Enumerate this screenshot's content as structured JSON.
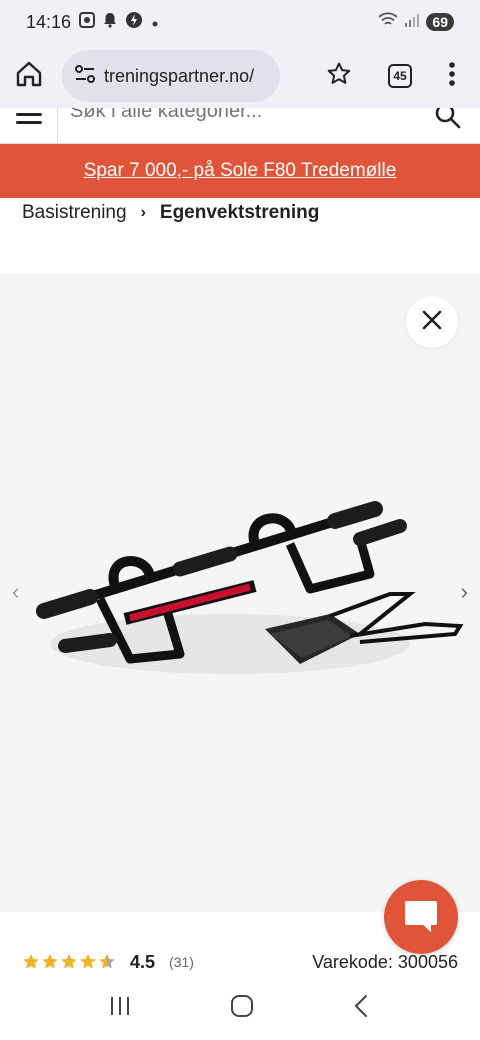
{
  "status": {
    "time": "14:16",
    "battery": "69",
    "left_icons": [
      "screenshot-icon",
      "bell-icon",
      "bolt-icon",
      "dot-icon"
    ],
    "right_icons": [
      "wifi-icon",
      "signal-icon"
    ]
  },
  "browser": {
    "url": "treningspartner.no/",
    "tab_count": "45",
    "icons": [
      "home-icon",
      "site-settings-icon",
      "star-icon",
      "tabs-icon",
      "more-vert-icon"
    ]
  },
  "search": {
    "placeholder": "Søk i alle kategorier..."
  },
  "promo": {
    "text": "Spar 7 000,- på Sole F80 Tredemølle"
  },
  "breadcrumb": {
    "parent": "Basistrening",
    "separator": "›",
    "current": "Egenvektstrening"
  },
  "gallery": {
    "prev": "‹",
    "next": "›"
  },
  "product": {
    "rating": "4.5",
    "rating_fraction": 0.9,
    "review_count": "(31)",
    "sku": "Varekode: 300056"
  },
  "colors": {
    "accent": "#e0553a",
    "star": "#f0b429"
  }
}
